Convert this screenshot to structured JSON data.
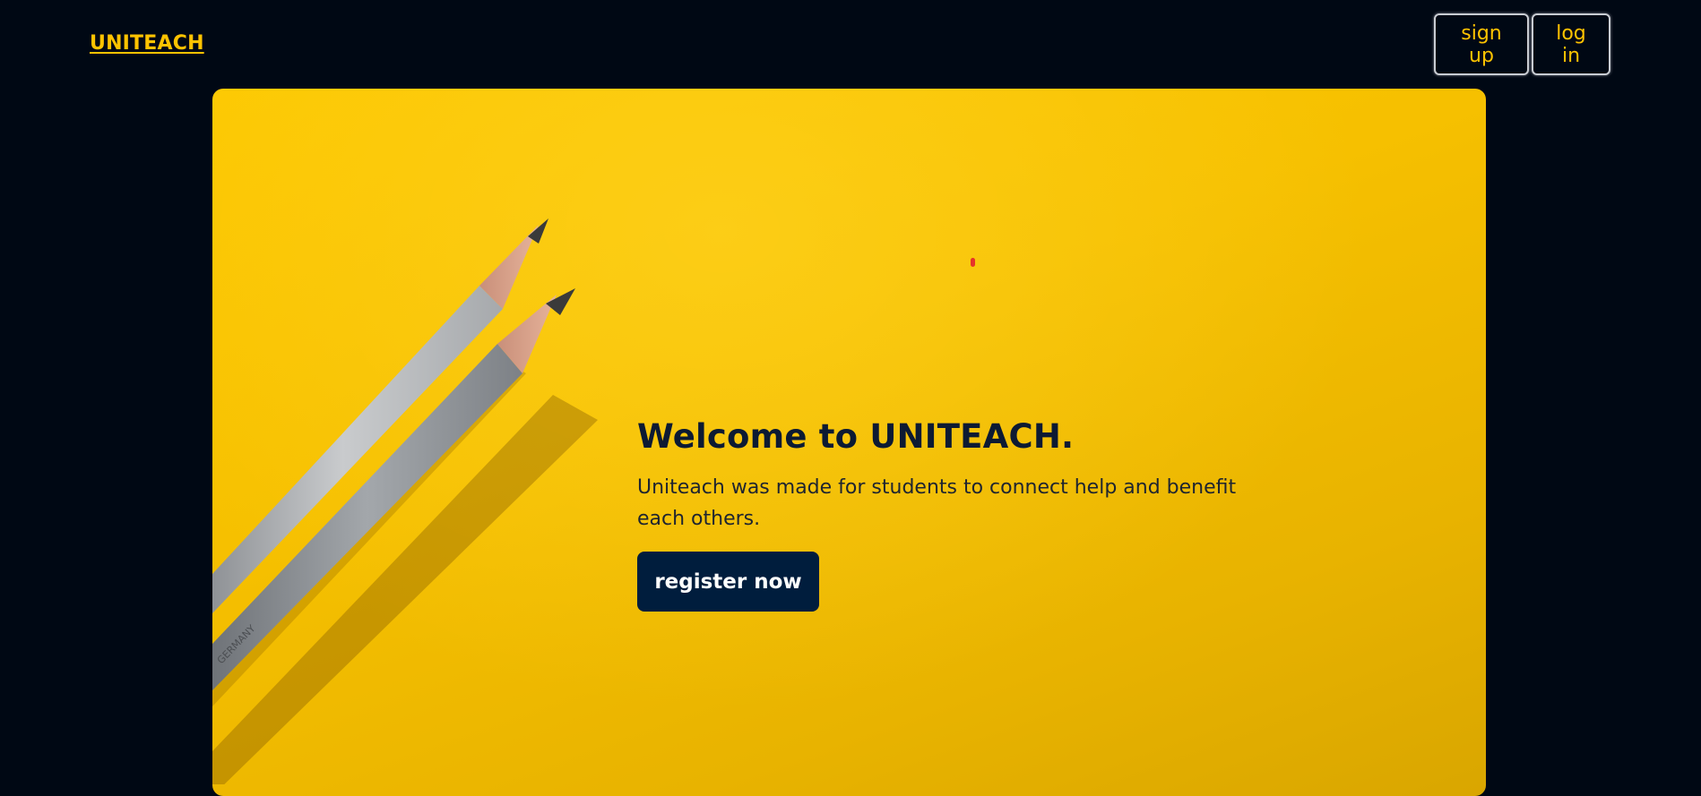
{
  "header": {
    "logo_text": "UNITEACH",
    "nav": {
      "signup_label": "sign up",
      "login_label": "log in"
    }
  },
  "hero": {
    "title": "Welcome to UNITEACH.",
    "description": "Uniteach was made for students to connect help and benefit each others.",
    "cta_label": "register now",
    "image_icon": "pencils-on-yellow-paper"
  },
  "colors": {
    "background": "#000814",
    "accent": "#ffc300",
    "hero_yellow": "#f6c000",
    "cta_background": "#001d3d",
    "cta_text": "#ffffff",
    "heading_text": "#0c1a33"
  }
}
